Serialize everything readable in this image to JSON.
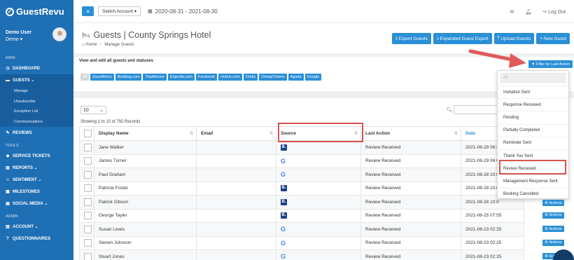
{
  "brand": "GuestRevu",
  "user": {
    "name": "Demo User",
    "org": "Demo"
  },
  "sidebar": {
    "main_label": "MAIN",
    "dashboard": "DASHBOARD",
    "guests": "GUESTS",
    "guests_sub": [
      "Manage",
      "Unsubscribe",
      "Exception List",
      "Communications"
    ],
    "reviews": "REVIEWS",
    "tools_label": "TOOLS",
    "tools": [
      "SERVICE TICKETS",
      "REPORTS",
      "SENTIMENT",
      "MILESTONES",
      "SOCIAL MEDIA"
    ],
    "admin_label": "ADMIN",
    "admin": [
      "ACCOUNT",
      "QUESTIONNAIRES"
    ]
  },
  "topbar": {
    "switch_account": "Switch Account",
    "date_range": "2020-08-31 - 2021-08-30",
    "logout": "Log Out"
  },
  "page": {
    "title": "Guests | County Springs Hotel",
    "breadcrumb_home": "Home",
    "breadcrumb_current": "Manage Guests",
    "buttons": [
      "Export Guests",
      "Expanded Guest Export",
      "Upload Guests",
      "+ New Guest"
    ],
    "view_text": "View and edit all guests and statuses",
    "filter_button": "Filter by Last Action"
  },
  "chips": [
    "All",
    "GuestRevu",
    "Booking.com",
    "TripAdvisor",
    "Expedia.com",
    "Facebook",
    "Hotels.com",
    "Orbitz",
    "CheapTickets",
    "Agoda",
    "Google"
  ],
  "table": {
    "page_size": "10",
    "records_info": "Showing 1 to 10 of 792 Records",
    "columns": [
      "Display Name",
      "Email",
      "Source",
      "Last Action",
      "Date"
    ],
    "rows": [
      {
        "name": "Jane Walker",
        "source": "B",
        "last_action": "Review Received",
        "date": "2021-08-29 06:4"
      },
      {
        "name": "James Turner",
        "source": "G",
        "last_action": "Review Received",
        "date": "2021-08-29 06:0"
      },
      {
        "name": "Paul Graham",
        "source": "G",
        "last_action": "Review Received",
        "date": "2021-08-28 10:0"
      },
      {
        "name": "Patricia Foster",
        "source": "B",
        "last_action": "Review Received",
        "date": "2021-08-28 10:0"
      },
      {
        "name": "Patrick Gibson",
        "source": "B",
        "last_action": "Review Received",
        "date": "2021-08-28 10:0"
      },
      {
        "name": "George Tayler",
        "source": "B",
        "last_action": "Review Received",
        "date": "2021-08-25 07:55"
      },
      {
        "name": "Susan Lewis",
        "source": "G",
        "last_action": "Review Received",
        "date": "2021-08-23 02:25"
      },
      {
        "name": "Steven Johnson",
        "source": "G",
        "last_action": "Review Received",
        "date": "2021-08-23 02:25"
      },
      {
        "name": "Stuart Jones",
        "source": "G",
        "last_action": "Review Received",
        "date": "2021-08-23 02:25"
      }
    ]
  },
  "dropdown": {
    "search_placeholder": "All",
    "items": [
      "Invitation Sent",
      "Response Received",
      "Pending",
      "Partially Completed",
      "Reminder Sent",
      "Thank You Sent",
      "Review Received",
      "Management Response Sent",
      "Booking Cancelled"
    ]
  },
  "actions_label": "Actions",
  "colors": {
    "primary": "#2a8fd6",
    "sidebar": "#1f6fb5",
    "highlight": "#d9534f",
    "arrow": "#e05a5a"
  }
}
